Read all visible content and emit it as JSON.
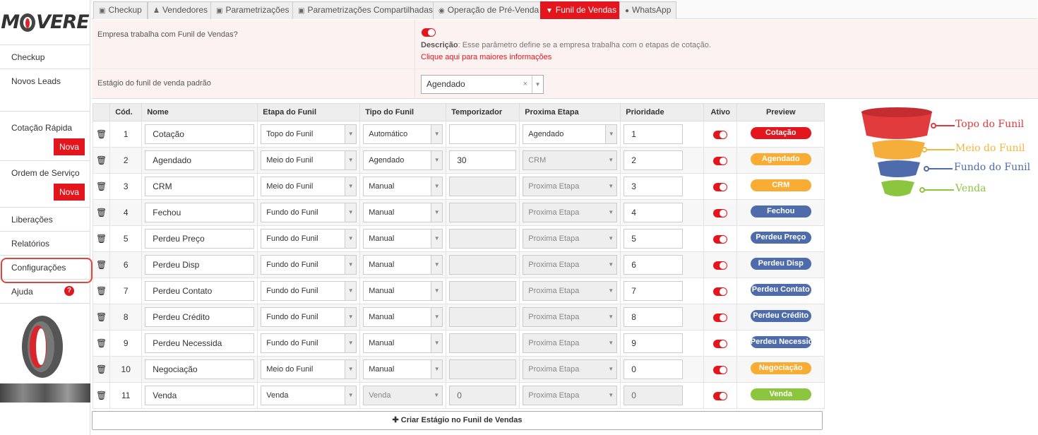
{
  "brand": {
    "logo_left": "M",
    "logo_right": "VERE"
  },
  "sidebar": {
    "items": [
      {
        "label": "Checkup"
      },
      {
        "label": "Novos Leads"
      },
      {
        "label": "Cotação Rápida",
        "button": "Nova"
      },
      {
        "label": "Ordem de Serviço",
        "button": "Nova"
      },
      {
        "label": "Liberações"
      },
      {
        "label": "Relatórios"
      },
      {
        "label": "Configurações"
      },
      {
        "label": "Ajuda"
      }
    ]
  },
  "tabs": [
    {
      "label": "Checkup",
      "icon": "car-icon"
    },
    {
      "label": "Vendedores",
      "icon": "user-icon"
    },
    {
      "label": "Parametrizações",
      "icon": "car-icon"
    },
    {
      "label": "Parametrizações Compartilhadas",
      "icon": "car-icon"
    },
    {
      "label": "Operação de Pré-Venda",
      "icon": "headset-icon"
    },
    {
      "label": "Funil de Vendas",
      "icon": "filter-icon",
      "active": true
    },
    {
      "label": "WhatsApp",
      "icon": "chat-icon"
    }
  ],
  "settings": {
    "question": "Empresa trabalha com Funil de Vendas?",
    "toggle_on": true,
    "desc_label": "Descrição",
    "desc_text": ": Esse parâmetro define se a empresa trabalha com o etapas de cotação.",
    "more_info": "Clique aqui para maiores informações",
    "stage_label": "Estágio do funil de venda padrão",
    "stage_value": "Agendado",
    "clear_icon": "×"
  },
  "table": {
    "headers": [
      "",
      "Cód.",
      "Nome",
      "Etapa do Funil",
      "Tipo do Funil",
      "Temporizador",
      "Proxima Etapa",
      "Prioridade",
      "Ativo",
      "Preview"
    ],
    "rows": [
      {
        "cod": "1",
        "nome": "Cotação",
        "etapa": "Topo do Funil",
        "tipo": "Automático",
        "temporizador": "",
        "timer_disabled": false,
        "proxima": "Agendado",
        "proxima_disabled": false,
        "prioridade": "1",
        "prio_disabled": false,
        "tipo_disabled": false,
        "preview": "Cotação",
        "color": "#e3161d"
      },
      {
        "cod": "2",
        "nome": "Agendado",
        "etapa": "Meio do Funil",
        "tipo": "Agendado",
        "temporizador": "30",
        "timer_disabled": false,
        "proxima": "CRM",
        "proxima_disabled": true,
        "prioridade": "2",
        "prio_disabled": false,
        "tipo_disabled": false,
        "preview": "Agendado",
        "color": "#f8ac33"
      },
      {
        "cod": "3",
        "nome": "CRM",
        "etapa": "Meio do Funil",
        "tipo": "Manual",
        "temporizador": "",
        "timer_disabled": true,
        "proxima": "Proxima Etapa",
        "proxima_disabled": true,
        "prioridade": "3",
        "prio_disabled": false,
        "tipo_disabled": false,
        "preview": "CRM",
        "color": "#f8ac33"
      },
      {
        "cod": "4",
        "nome": "Fechou",
        "etapa": "Fundo do Funil",
        "tipo": "Manual",
        "temporizador": "",
        "timer_disabled": true,
        "proxima": "Proxima Etapa",
        "proxima_disabled": true,
        "prioridade": "4",
        "prio_disabled": false,
        "tipo_disabled": false,
        "preview": "Fechou",
        "color": "#4e6bab"
      },
      {
        "cod": "5",
        "nome": "Perdeu Preço",
        "etapa": "Fundo do Funil",
        "tipo": "Manual",
        "temporizador": "",
        "timer_disabled": true,
        "proxima": "Proxima Etapa",
        "proxima_disabled": true,
        "prioridade": "5",
        "prio_disabled": false,
        "tipo_disabled": false,
        "preview": "Perdeu Preço",
        "color": "#4e6bab"
      },
      {
        "cod": "6",
        "nome": "Perdeu Disp",
        "etapa": "Fundo do Funil",
        "tipo": "Manual",
        "temporizador": "",
        "timer_disabled": true,
        "proxima": "Proxima Etapa",
        "proxima_disabled": true,
        "prioridade": "6",
        "prio_disabled": false,
        "tipo_disabled": false,
        "preview": "Perdeu Disp",
        "color": "#4e6bab"
      },
      {
        "cod": "7",
        "nome": "Perdeu Contato",
        "etapa": "Fundo do Funil",
        "tipo": "Manual",
        "temporizador": "",
        "timer_disabled": true,
        "proxima": "Proxima Etapa",
        "proxima_disabled": true,
        "prioridade": "7",
        "prio_disabled": false,
        "tipo_disabled": false,
        "preview": "Perdeu Contato",
        "color": "#4e6bab"
      },
      {
        "cod": "8",
        "nome": "Perdeu Crédito",
        "etapa": "Fundo do Funil",
        "tipo": "Manual",
        "temporizador": "",
        "timer_disabled": true,
        "proxima": "Proxima Etapa",
        "proxima_disabled": true,
        "prioridade": "8",
        "prio_disabled": false,
        "tipo_disabled": false,
        "preview": "Perdeu Crédito",
        "color": "#4e6bab"
      },
      {
        "cod": "9",
        "nome": "Perdeu Necessida",
        "etapa": "Fundo do Funil",
        "tipo": "Manual",
        "temporizador": "",
        "timer_disabled": true,
        "proxima": "Proxima Etapa",
        "proxima_disabled": true,
        "prioridade": "9",
        "prio_disabled": false,
        "tipo_disabled": false,
        "preview": "Perdeu Necessidade",
        "color": "#4e6bab"
      },
      {
        "cod": "10",
        "nome": "Negociação",
        "etapa": "Meio do Funil",
        "tipo": "Manual",
        "temporizador": "",
        "timer_disabled": true,
        "proxima": "Proxima Etapa",
        "proxima_disabled": true,
        "prioridade": "0",
        "prio_disabled": false,
        "tipo_disabled": false,
        "preview": "Negociação",
        "color": "#f8ac33"
      },
      {
        "cod": "11",
        "nome": "Venda",
        "etapa": "Venda",
        "tipo": "Venda",
        "temporizador": "0",
        "timer_disabled": true,
        "proxima": "Proxima Etapa",
        "proxima_disabled": true,
        "prioridade": "0",
        "prio_disabled": true,
        "tipo_disabled": true,
        "preview": "Venda",
        "color": "#8cc63f"
      }
    ],
    "create_button": "Criar Estágio no Funil de Vendas"
  },
  "funnel_legend": [
    {
      "label": "Topo do Funil",
      "color": "#e03a3e"
    },
    {
      "label": "Meio do Funil",
      "color": "#f4b63f"
    },
    {
      "label": "Fundo do Funil",
      "color": "#4e6bab"
    },
    {
      "label": "Venda",
      "color": "#8cc63f"
    }
  ]
}
